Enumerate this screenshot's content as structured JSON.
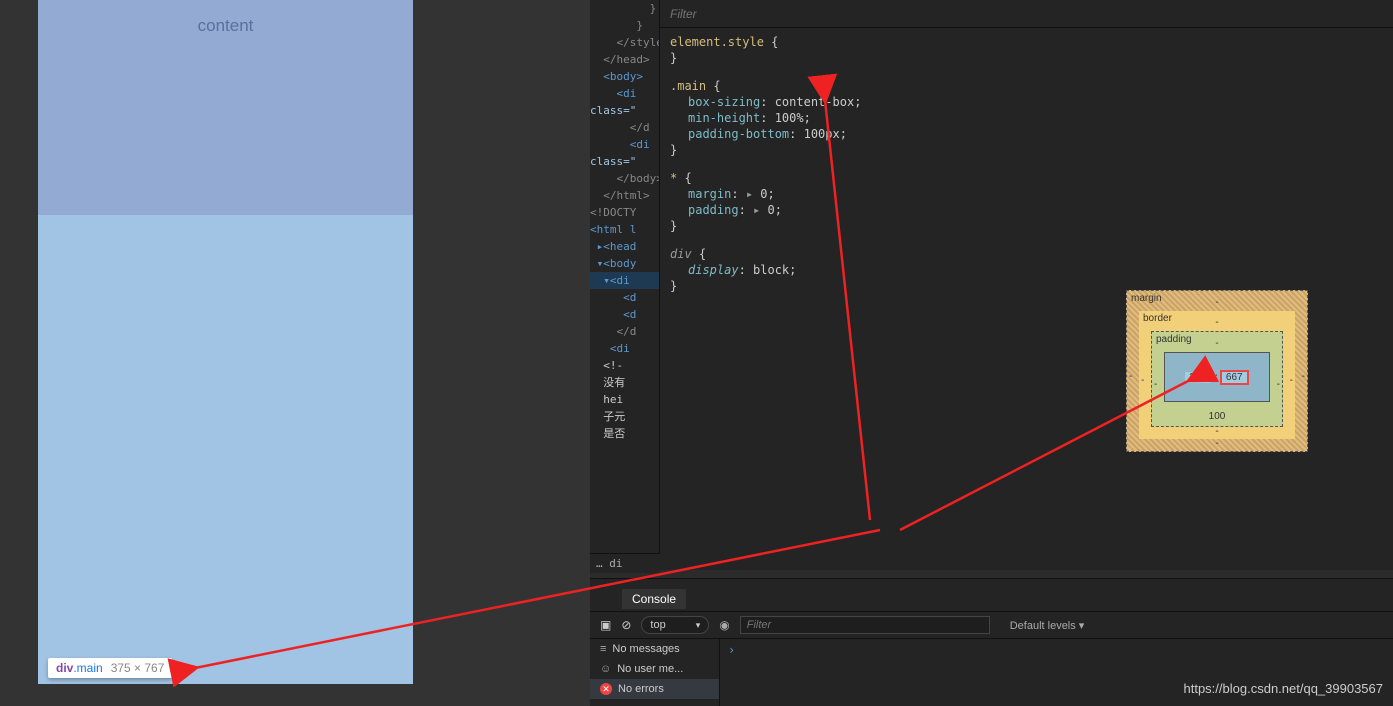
{
  "preview": {
    "content_label": "content",
    "tooltip_selector": "div",
    "tooltip_class": ".main",
    "tooltip_dim": "375 × 767"
  },
  "elements": {
    "lines": [
      "         }",
      "       }",
      "    </style>",
      "  </head>",
      "  <body>",
      "    <di",
      "",
      "class=\"",
      "      </d",
      "      <di",
      "class=\"",
      "    </body>",
      "  </html>",
      "<!DOCTY",
      "<html l",
      " ▸<head",
      " ▾<body",
      "  ▾<di",
      "     <d",
      "     <d",
      "    </d",
      "   <di",
      "  <!-",
      "  没有",
      "  hei",
      "  子元",
      "  是否"
    ],
    "breadcrumb": "…    di"
  },
  "styles": {
    "filter_placeholder": "Filter",
    "rule1_sel": "element.style",
    "rule2_sel": ".main",
    "rule2_p1_k": "box-sizing",
    "rule2_p1_v": "content-box",
    "rule2_p2_k": "min-height",
    "rule2_p2_v": "100%",
    "rule2_p3_k": "padding-bottom",
    "rule2_p3_v": "100px",
    "rule3_sel": "*",
    "rule3_p1_k": "margin",
    "rule3_p1_v": "0",
    "rule3_p2_k": "padding",
    "rule3_p2_v": "0",
    "rule4_sel": "div",
    "rule4_p1_k": "display",
    "rule4_p1_v": "block"
  },
  "box_model": {
    "margin_label": "margin",
    "border_label": "border",
    "padding_label": "padding",
    "width": "375",
    "height": "667",
    "padding_bottom": "100"
  },
  "console": {
    "title": "Console",
    "context": "top",
    "filter_placeholder": "Filter",
    "levels": "Default levels ▾",
    "no_messages": "No messages",
    "no_user": "No user me...",
    "no_errors": "No errors"
  },
  "watermark": "https://blog.csdn.net/qq_39903567"
}
